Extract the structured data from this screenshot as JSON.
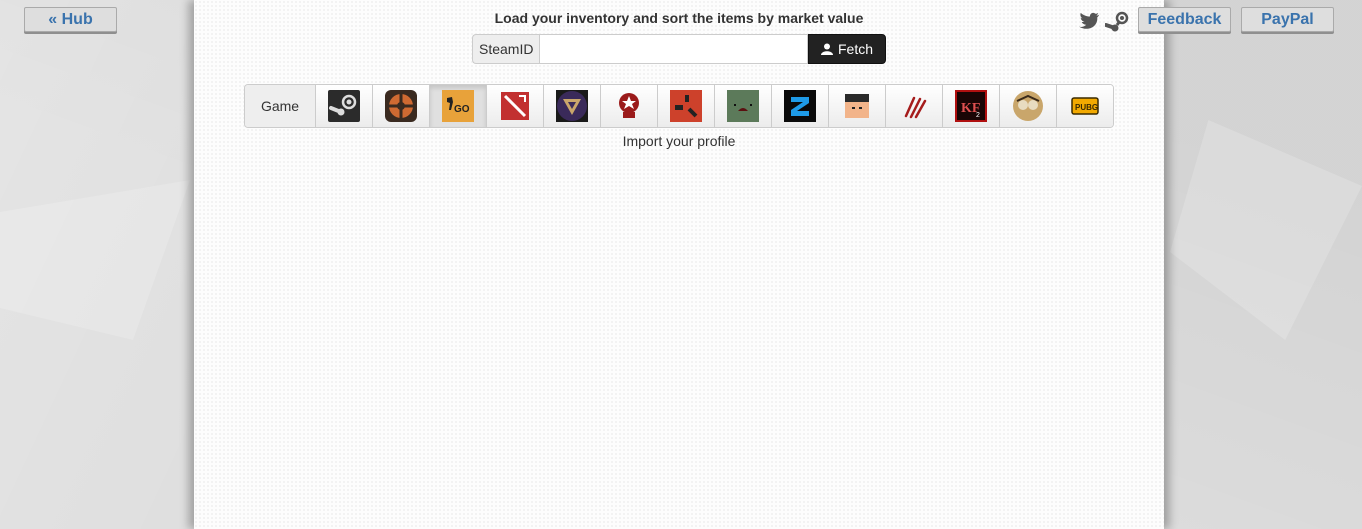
{
  "nav": {
    "hub_label": "« Hub",
    "feedback_label": "Feedback",
    "paypal_label": "PayPal",
    "social_icons": [
      "twitter-icon",
      "steam-icon"
    ]
  },
  "header": {
    "title": "Load your inventory and sort the items by market value"
  },
  "search": {
    "addon_label": "SteamID",
    "value": "",
    "placeholder": "",
    "fetch_label": "Fetch",
    "fetch_icon": "user-icon"
  },
  "games": {
    "label": "Game",
    "selected": "Counter-Strike: Global Offensive",
    "items": [
      {
        "name": "Steam",
        "icon": "steam-game-icon",
        "color": "#2a2a2a"
      },
      {
        "name": "Team Fortress 2",
        "icon": "tf2-icon",
        "color": "#cf6a32"
      },
      {
        "name": "Counter-Strike: Global Offensive",
        "icon": "csgo-icon",
        "color": "#e8a23a"
      },
      {
        "name": "Dota 2",
        "icon": "dota2-icon",
        "color": "#c23030"
      },
      {
        "name": "Artifact-like",
        "icon": "purple-triangle-icon",
        "color": "#3a2a5a"
      },
      {
        "name": "Red skull game",
        "icon": "red-skull-icon",
        "color": "#9b1b1b"
      },
      {
        "name": "Rust",
        "icon": "rust-icon",
        "color": "#cd412b"
      },
      {
        "name": "Unturned",
        "icon": "unturned-icon",
        "color": "#5c7a5a"
      },
      {
        "name": "Payday 2",
        "icon": "payday2-icon",
        "color": "#1e9be8"
      },
      {
        "name": "BattleBlock Theater",
        "icon": "battleblock-icon",
        "color": "#f2b48a"
      },
      {
        "name": "Killing Floor",
        "icon": "claw-icon",
        "color": "#a51c1c"
      },
      {
        "name": "Killing Floor 2",
        "icon": "kf2-icon",
        "color": "#b01010"
      },
      {
        "name": "Don't Starve Together",
        "icon": "dont-starve-icon",
        "color": "#c9a66b"
      },
      {
        "name": "PUBG",
        "icon": "pubg-icon",
        "color": "#f2a900"
      }
    ]
  },
  "status": {
    "message": "Import your profile"
  }
}
